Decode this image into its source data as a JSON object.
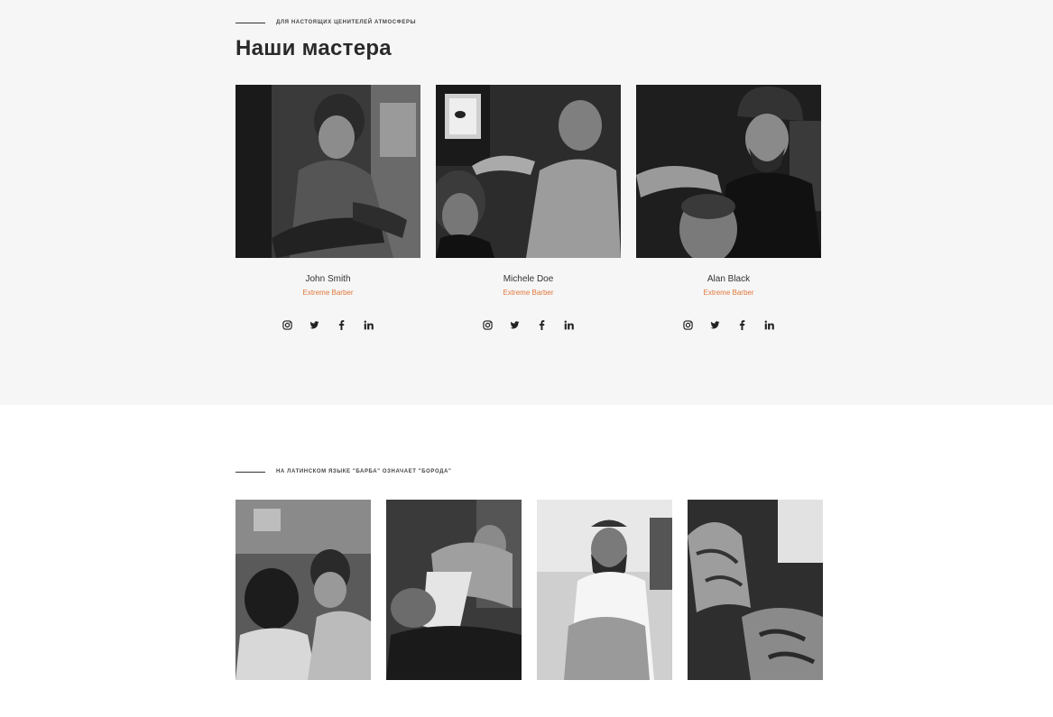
{
  "masters_section": {
    "kicker": "для настоящих ценителей атмосферы",
    "title": "Наши мастера",
    "masters": [
      {
        "name": "John Smith",
        "role": "Extreme Barber"
      },
      {
        "name": "Michele Doe",
        "role": "Extreme Barber"
      },
      {
        "name": "Alan Black",
        "role": "Extreme Barber"
      }
    ],
    "social_icons": [
      "instagram-icon",
      "twitter-icon",
      "facebook-icon",
      "linkedin-icon"
    ]
  },
  "gallery_section": {
    "kicker": "на латинском языке \"барба\" означает \"борода\""
  },
  "colors": {
    "accent": "#e0783c",
    "section_bg": "#f6f6f6",
    "text_dark": "#2a2a2a"
  }
}
